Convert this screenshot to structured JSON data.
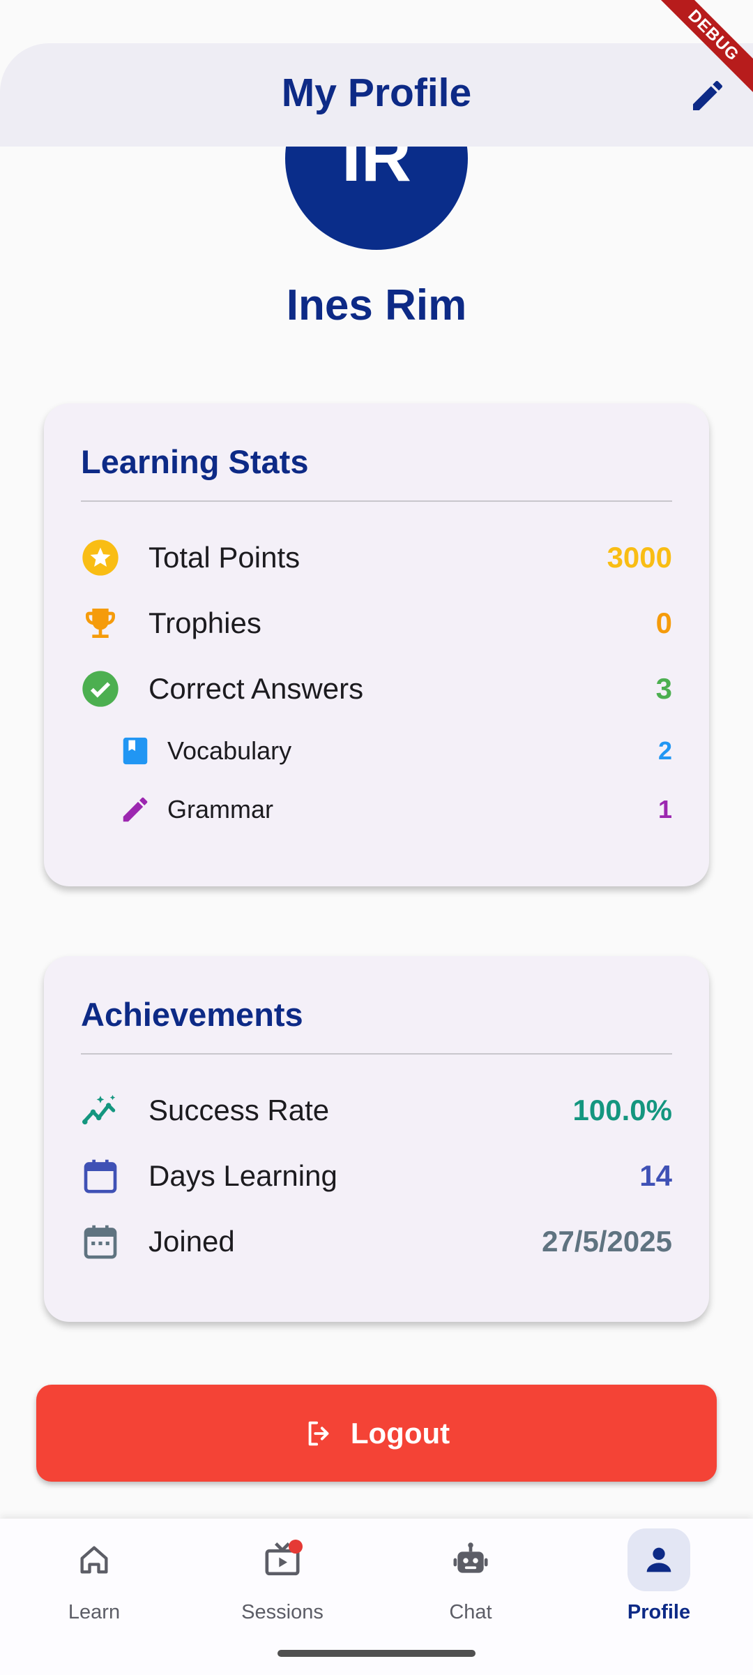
{
  "debug_banner": "DEBUG",
  "appbar": {
    "title": "My Profile",
    "edit_icon": "edit-icon"
  },
  "profile": {
    "initials": "IR",
    "name": "Ines Rim"
  },
  "learning_stats": {
    "title": "Learning Stats",
    "rows": [
      {
        "label": "Total Points",
        "value": "3000",
        "icon": "star-circle-icon",
        "color": "#f9bd14"
      },
      {
        "label": "Trophies",
        "value": "0",
        "icon": "trophy-icon",
        "color": "#f59b0b"
      },
      {
        "label": "Correct Answers",
        "value": "3",
        "icon": "check-circle-icon",
        "color": "#4caf50"
      },
      {
        "label": "Vocabulary",
        "value": "2",
        "icon": "book-icon",
        "color": "#2196f3"
      },
      {
        "label": "Grammar",
        "value": "1",
        "icon": "pencil-icon",
        "color": "#9c27b0"
      }
    ]
  },
  "achievements": {
    "title": "Achievements",
    "rows": [
      {
        "label": "Success Rate",
        "value": "100.0%",
        "icon": "trending-up-icon",
        "color": "#14967f"
      },
      {
        "label": "Days Learning",
        "value": "14",
        "icon": "calendar-icon",
        "color": "#3f51b5"
      },
      {
        "label": "Joined",
        "value": "27/5/2025",
        "icon": "calendar-month-icon",
        "color": "#5f7380"
      }
    ]
  },
  "logout": {
    "label": "Logout",
    "color": "#f44336"
  },
  "bottom_nav": {
    "items": [
      {
        "label": "Learn",
        "icon": "home-icon"
      },
      {
        "label": "Sessions",
        "icon": "live-tv-icon"
      },
      {
        "label": "Chat",
        "icon": "robot-icon"
      },
      {
        "label": "Profile",
        "icon": "person-icon",
        "active": true
      }
    ]
  }
}
